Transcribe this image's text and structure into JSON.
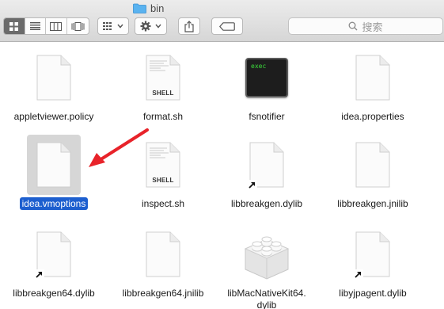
{
  "window": {
    "title": "bin"
  },
  "toolbar": {
    "view_modes": [
      "icon-view-icon",
      "list-view-icon",
      "column-view-icon",
      "cover-flow-icon"
    ],
    "search_placeholder": "搜索"
  },
  "files": [
    {
      "name": "appletviewer.policy",
      "type": "document"
    },
    {
      "name": "format.sh",
      "type": "shell",
      "badge": "SHELL"
    },
    {
      "name": "fsnotifier",
      "type": "exec",
      "badge": "exec"
    },
    {
      "name": "idea.properties",
      "type": "document"
    },
    {
      "name": "idea.vmoptions",
      "type": "document",
      "selected": true
    },
    {
      "name": "inspect.sh",
      "type": "shell",
      "badge": "SHELL"
    },
    {
      "name": "libbreakgen.dylib",
      "type": "alias"
    },
    {
      "name": "libbreakgen.jnilib",
      "type": "document"
    },
    {
      "name": "libbreakgen64.dylib",
      "type": "alias"
    },
    {
      "name": "libbreakgen64.jnilib",
      "type": "document"
    },
    {
      "name": "libMacNativeKit64.\ndylib",
      "type": "lego"
    },
    {
      "name": "libyjpagent.dylib",
      "type": "alias"
    }
  ],
  "colors": {
    "selection": "#1d5fcf",
    "annotation_arrow": "#e8232a"
  }
}
